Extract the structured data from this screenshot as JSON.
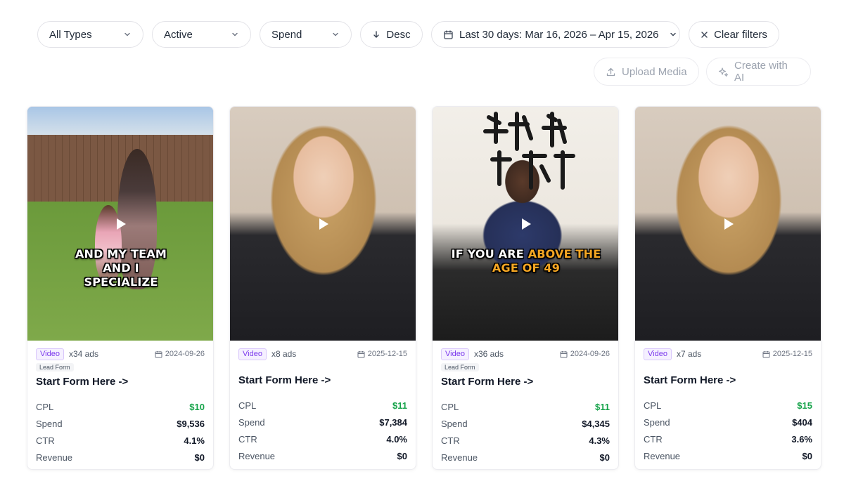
{
  "filters": {
    "type": "All Types",
    "status": "Active",
    "sort_metric": "Spend",
    "sort_order": "Desc",
    "date_range": "Last 30 days: Mar 16, 2026 – Apr 15, 2026",
    "clear": "Clear filters"
  },
  "actions": {
    "upload": "Upload Media",
    "create": "Create with AI"
  },
  "colors": {
    "accent_purple": "#7c3aed",
    "positive_green": "#16a34a"
  },
  "stat_labels": {
    "cpl": "CPL",
    "spend": "Spend",
    "ctr": "CTR",
    "revenue": "Revenue"
  },
  "cards": [
    {
      "media_type": "Video",
      "ads": "x34 ads",
      "date": "2024-09-26",
      "lead_form": "Lead Form",
      "title": "Start Form Here ->",
      "caption_main": "AND MY TEAM AND I SPECIALIZE",
      "cpl": "$10",
      "spend": "$9,536",
      "ctr": "4.1%",
      "revenue": "$0"
    },
    {
      "media_type": "Video",
      "ads": "x8 ads",
      "date": "2025-12-15",
      "title": "Start Form Here ->",
      "cpl": "$11",
      "spend": "$7,384",
      "ctr": "4.0%",
      "revenue": "$0"
    },
    {
      "media_type": "Video",
      "ads": "x36 ads",
      "date": "2024-09-26",
      "lead_form": "Lead Form",
      "title": "Start Form Here ->",
      "caption_pre": "IF YOU ARE ",
      "caption_hl": "ABOVE THE AGE OF 49",
      "cpl": "$11",
      "spend": "$4,345",
      "ctr": "4.3%",
      "revenue": "$0"
    },
    {
      "media_type": "Video",
      "ads": "x7 ads",
      "date": "2025-12-15",
      "title": "Start Form Here ->",
      "cpl": "$15",
      "spend": "$404",
      "ctr": "3.6%",
      "revenue": "$0"
    }
  ]
}
